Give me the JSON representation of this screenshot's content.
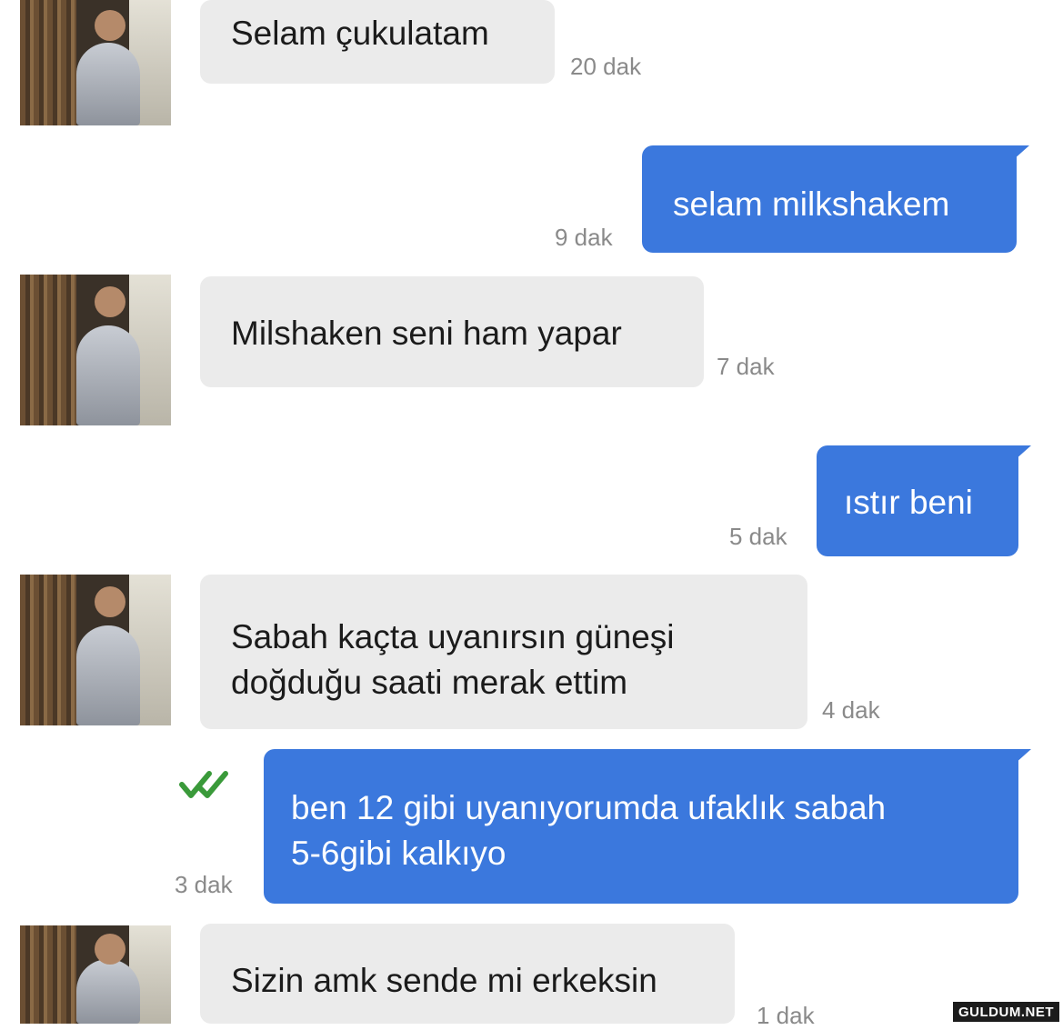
{
  "messages": [
    {
      "text": "Selam çukulatam",
      "time": "20 dak",
      "icon": "contact-avatar"
    },
    {
      "text": "selam milkshakem",
      "time": "9 dak"
    },
    {
      "text": "Milshaken seni ham yapar",
      "time": "7 dak",
      "icon": "contact-avatar"
    },
    {
      "text": "ıstır beni",
      "time": "5 dak"
    },
    {
      "text_line1": "Sabah kaçta uyanırsın güneşi",
      "text_line2": "doğduğu saati merak ettim",
      "time": "4 dak",
      "icon": "contact-avatar"
    },
    {
      "text_line1": "ben 12 gibi uyanıyorumda ufaklık sabah",
      "text_line2": "5-6gibi kalkıyo",
      "time": "3 dak",
      "status_icon": "double-check-icon"
    },
    {
      "text": "Sizin amk sende mi erkeksin",
      "time": "1 dak",
      "icon": "contact-avatar"
    }
  ],
  "colors": {
    "incoming_bubble": "#ebebeb",
    "outgoing_bubble": "#3b78dd",
    "read_check": "#3a9a3a"
  },
  "watermark": "GULDUM.NET"
}
